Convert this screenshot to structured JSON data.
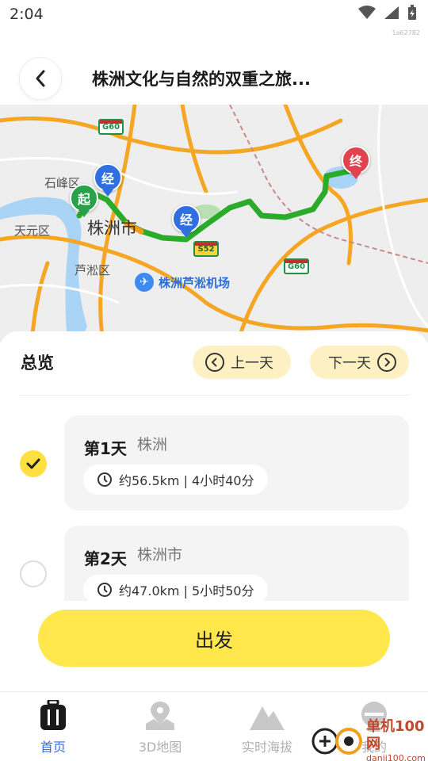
{
  "status": {
    "time": "2:04",
    "tiny_label": "1a62782"
  },
  "header": {
    "title": "株洲文化与自然的双重之旅..."
  },
  "map": {
    "labels": [
      "石峰区",
      "株洲市",
      "天元区",
      "芦淞区"
    ],
    "airport": "株洲芦淞机场",
    "highways": [
      "G60",
      "S52",
      "G60"
    ],
    "pins": {
      "start": "起",
      "via": "经",
      "end": "终"
    },
    "colors": {
      "route": "#2aab2a",
      "start": "#27a24a",
      "via": "#2f6fe0",
      "end": "#e0434d"
    }
  },
  "sheet": {
    "overview": "总览",
    "prev_day": "上一天",
    "next_day": "下一天",
    "days": [
      {
        "title": "第1天",
        "city": "株洲",
        "metric": "约56.5km | 4小时40分",
        "checked": true
      },
      {
        "title": "第2天",
        "city": "株洲市",
        "metric": "约47.0km | 5小时50分",
        "checked": false
      }
    ]
  },
  "depart_button": "出发",
  "nav": {
    "items": [
      {
        "label": "首页",
        "icon": "luggage-icon",
        "active": true
      },
      {
        "label": "3D地图",
        "icon": "map-pin-icon",
        "active": false
      },
      {
        "label": "实时海拔",
        "icon": "mountain-icon",
        "active": false
      },
      {
        "label": "我的",
        "icon": "profile-icon",
        "active": false
      }
    ]
  },
  "watermark": {
    "brand": "单机100网",
    "site": "danji100.com"
  }
}
